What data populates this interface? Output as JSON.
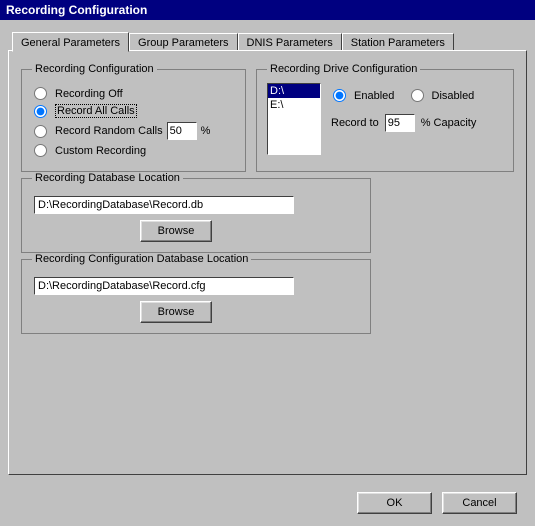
{
  "window": {
    "title": "Recording Configuration"
  },
  "tabs": {
    "general": "General Parameters",
    "group": "Group Parameters",
    "dnis": "DNIS Parameters",
    "station": "Station Parameters"
  },
  "recording_config": {
    "legend": "Recording Configuration",
    "off": "Recording Off",
    "all": "Record All Calls",
    "random": "Record Random Calls",
    "random_pct": "50",
    "pct_symbol": "%",
    "custom": "Custom Recording",
    "selected": "all"
  },
  "drive_config": {
    "legend": "Recording Drive Configuration",
    "drives": [
      "D:\\",
      "E:\\"
    ],
    "selected_drive": "D:\\",
    "enabled": "Enabled",
    "disabled": "Disabled",
    "state": "enabled",
    "record_to_label": "Record to",
    "capacity_value": "95",
    "capacity_suffix": "% Capacity"
  },
  "db_location": {
    "legend": "Recording Database Location",
    "path": "D:\\RecordingDatabase\\Record.db",
    "browse": "Browse"
  },
  "cfg_location": {
    "legend": "Recording Configuration Database Location",
    "path": "D:\\RecordingDatabase\\Record.cfg",
    "browse": "Browse"
  },
  "buttons": {
    "ok": "OK",
    "cancel": "Cancel"
  }
}
